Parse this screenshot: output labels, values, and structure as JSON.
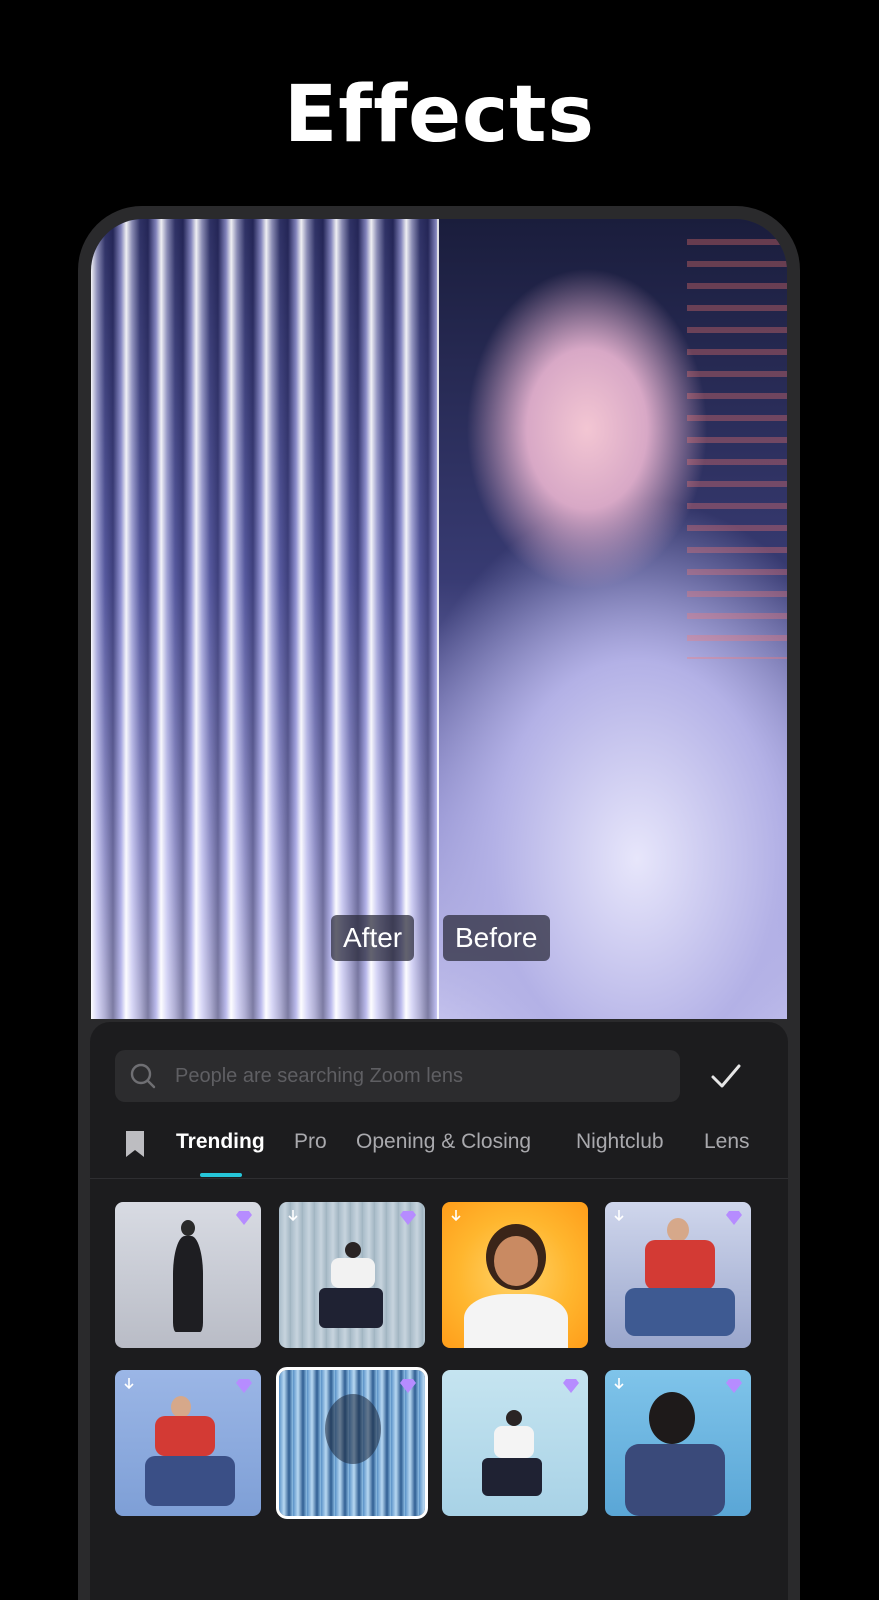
{
  "title": "Effects",
  "preview": {
    "after_label": "After",
    "before_label": "Before"
  },
  "search": {
    "placeholder": "People are searching Zoom lens"
  },
  "tabs": [
    {
      "label": "Trending",
      "active": true
    },
    {
      "label": "Pro",
      "active": false
    },
    {
      "label": "Opening & Closing",
      "active": false
    },
    {
      "label": "Nightclub",
      "active": false
    },
    {
      "label": "Lens",
      "active": false
    }
  ],
  "icons": {
    "search": "search-icon",
    "confirm": "check-icon",
    "bookmark": "bookmark-icon",
    "download": "download-icon",
    "premium": "diamond-icon"
  },
  "colors": {
    "accent": "#26c6d9",
    "panel": "#1c1c1e",
    "premium": "#b68cff"
  },
  "effects_grid": [
    {
      "has_download": false,
      "is_premium": true,
      "selected": false
    },
    {
      "has_download": true,
      "is_premium": true,
      "selected": false
    },
    {
      "has_download": true,
      "is_premium": false,
      "selected": false
    },
    {
      "has_download": true,
      "is_premium": true,
      "selected": false
    },
    {
      "has_download": true,
      "is_premium": true,
      "selected": false
    },
    {
      "has_download": false,
      "is_premium": true,
      "selected": true
    },
    {
      "has_download": false,
      "is_premium": true,
      "selected": false
    },
    {
      "has_download": true,
      "is_premium": true,
      "selected": false
    }
  ]
}
